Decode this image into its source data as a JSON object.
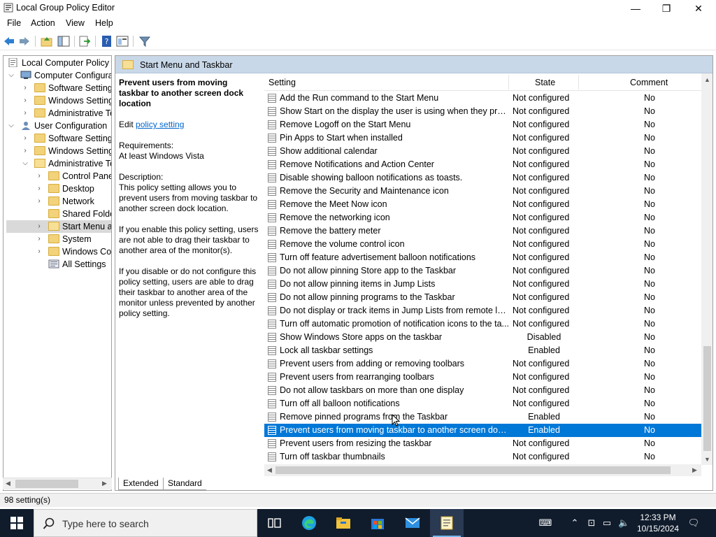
{
  "window": {
    "title": "Local Group Policy Editor",
    "minimize_glyph": "—",
    "restore_glyph": "❐",
    "close_glyph": "✕"
  },
  "menu": [
    "File",
    "Action",
    "View",
    "Help"
  ],
  "tree": [
    {
      "label": "Local Computer Policy"
    },
    {
      "label": "Computer Configura"
    },
    {
      "label": "Software Settings"
    },
    {
      "label": "Windows Setting"
    },
    {
      "label": "Administrative Te"
    },
    {
      "label": "User Configuration"
    },
    {
      "label": "Software Settings"
    },
    {
      "label": "Windows Setting"
    },
    {
      "label": "Administrative Te"
    },
    {
      "label": "Control Panel"
    },
    {
      "label": "Desktop"
    },
    {
      "label": "Network"
    },
    {
      "label": "Shared Folder"
    },
    {
      "label": "Start Menu ar"
    },
    {
      "label": "System"
    },
    {
      "label": "Windows Cor"
    },
    {
      "label": "All Settings"
    }
  ],
  "right_header": "Start Menu and Taskbar",
  "description": {
    "title": "Prevent users from moving taskbar to another screen dock location",
    "edit_prefix": "Edit ",
    "edit_link": "policy setting ",
    "requirements_label": "Requirements:",
    "requirements_value": "At least Windows Vista",
    "description_label": "Description:",
    "description_text": "This policy setting allows you to prevent users from moving taskbar to another screen dock location.",
    "enable_text": "If you enable this policy setting, users are not able to drag their taskbar to another area of the monitor(s).",
    "disable_text": "If you disable or do not configure this policy setting, users are able to drag their taskbar to another area of the monitor unless prevented by another policy setting."
  },
  "columns": {
    "setting": "Setting",
    "state": "State",
    "comment": "Comment"
  },
  "rows": [
    {
      "name": "Add the Run command to the Start Menu",
      "state": "Not configured",
      "comment": "No"
    },
    {
      "name": "Show Start on the display the user is using when they press t...",
      "state": "Not configured",
      "comment": "No"
    },
    {
      "name": "Remove Logoff on the Start Menu",
      "state": "Not configured",
      "comment": "No"
    },
    {
      "name": "Pin Apps to Start when installed",
      "state": "Not configured",
      "comment": "No"
    },
    {
      "name": "Show additional calendar",
      "state": "Not configured",
      "comment": "No"
    },
    {
      "name": "Remove Notifications and Action Center",
      "state": "Not configured",
      "comment": "No"
    },
    {
      "name": "Disable showing balloon notifications as toasts.",
      "state": "Not configured",
      "comment": "No"
    },
    {
      "name": "Remove the Security and Maintenance icon",
      "state": "Not configured",
      "comment": "No"
    },
    {
      "name": "Remove the Meet Now icon",
      "state": "Not configured",
      "comment": "No"
    },
    {
      "name": "Remove the networking icon",
      "state": "Not configured",
      "comment": "No"
    },
    {
      "name": "Remove the battery meter",
      "state": "Not configured",
      "comment": "No"
    },
    {
      "name": "Remove the volume control icon",
      "state": "Not configured",
      "comment": "No"
    },
    {
      "name": "Turn off feature advertisement balloon notifications",
      "state": "Not configured",
      "comment": "No"
    },
    {
      "name": "Do not allow pinning Store app to the Taskbar",
      "state": "Not configured",
      "comment": "No"
    },
    {
      "name": "Do not allow pinning items in Jump Lists",
      "state": "Not configured",
      "comment": "No"
    },
    {
      "name": "Do not allow pinning programs to the Taskbar",
      "state": "Not configured",
      "comment": "No"
    },
    {
      "name": "Do not display or track items in Jump Lists from remote loca...",
      "state": "Not configured",
      "comment": "No"
    },
    {
      "name": "Turn off automatic promotion of notification icons to the ta...",
      "state": "Not configured",
      "comment": "No"
    },
    {
      "name": "Show Windows Store apps on the taskbar",
      "state": "Disabled",
      "comment": "No"
    },
    {
      "name": "Lock all taskbar settings",
      "state": "Enabled",
      "comment": "No"
    },
    {
      "name": "Prevent users from adding or removing toolbars",
      "state": "Not configured",
      "comment": "No"
    },
    {
      "name": "Prevent users from rearranging toolbars",
      "state": "Not configured",
      "comment": "No"
    },
    {
      "name": "Do not allow taskbars on more than one display",
      "state": "Not configured",
      "comment": "No"
    },
    {
      "name": "Turn off all balloon notifications",
      "state": "Not configured",
      "comment": "No"
    },
    {
      "name": "Remove pinned programs from the Taskbar",
      "state": "Enabled",
      "comment": "No"
    },
    {
      "name": "Prevent users from moving taskbar to another screen dock l...",
      "state": "Enabled",
      "comment": "No"
    },
    {
      "name": "Prevent users from resizing the taskbar",
      "state": "Not configured",
      "comment": "No"
    },
    {
      "name": "Turn off taskbar thumbnails",
      "state": "Not configured",
      "comment": "No"
    }
  ],
  "tabs": {
    "extended": "Extended",
    "standard": "Standard"
  },
  "status": "98 setting(s)",
  "taskbar": {
    "search_placeholder": "Type here to search",
    "time": "12:33 PM",
    "date": "10/15/2024"
  },
  "colors": {
    "selection": "#0078d7",
    "header_band": "#c9d8e9",
    "taskbar": "#101c2c",
    "link": "#0066cc"
  }
}
